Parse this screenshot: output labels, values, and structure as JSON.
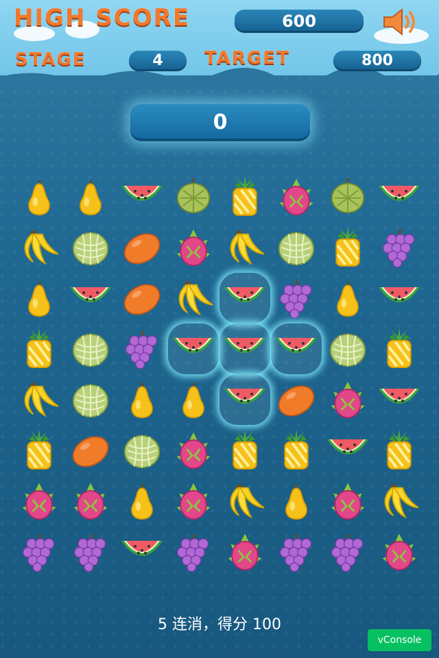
{
  "header": {
    "high_score_label": "HIGH SCORE",
    "high_score_value": "600",
    "stage_label": "STAGE",
    "stage_value": "4",
    "target_label": "TARGET",
    "target_value": "800",
    "sound_icon": "speaker-icon"
  },
  "current_score": "0",
  "colors": {
    "label_orange": "#f0792e",
    "pill_blue": "#1a6fa3",
    "highlight": "#8af0ff"
  },
  "board": {
    "rows": [
      [
        "pear",
        "pear",
        "watermelon",
        "durian",
        "pineapple",
        "dragonfruit",
        "durian",
        "watermelon"
      ],
      [
        "banana",
        "melon",
        "mango",
        "dragonfruit",
        "banana",
        "melon",
        "pineapple",
        "grape"
      ],
      [
        "pear",
        "watermelon",
        "mango",
        "banana",
        "watermelon",
        "grape",
        "pear",
        "watermelon"
      ],
      [
        "pineapple",
        "melon",
        "grape",
        "watermelon",
        "watermelon",
        "watermelon",
        "melon",
        "pineapple"
      ],
      [
        "banana",
        "melon",
        "pear",
        "pear",
        "watermelon",
        "mango",
        "dragonfruit",
        "watermelon"
      ],
      [
        "pineapple",
        "mango",
        "melon",
        "dragonfruit",
        "pineapple",
        "pineapple",
        "watermelon",
        "pineapple"
      ],
      [
        "dragonfruit",
        "dragonfruit",
        "pear",
        "dragonfruit",
        "banana",
        "pear",
        "dragonfruit",
        "banana"
      ],
      [
        "grape",
        "grape",
        "watermelon",
        "grape",
        "dragonfruit",
        "grape",
        "grape",
        "dragonfruit"
      ]
    ],
    "highlighted": [
      [
        2,
        4
      ],
      [
        3,
        3
      ],
      [
        3,
        4
      ],
      [
        3,
        5
      ],
      [
        4,
        4
      ]
    ]
  },
  "status_text": "5 连消，得分 100",
  "vconsole_label": "vConsole"
}
